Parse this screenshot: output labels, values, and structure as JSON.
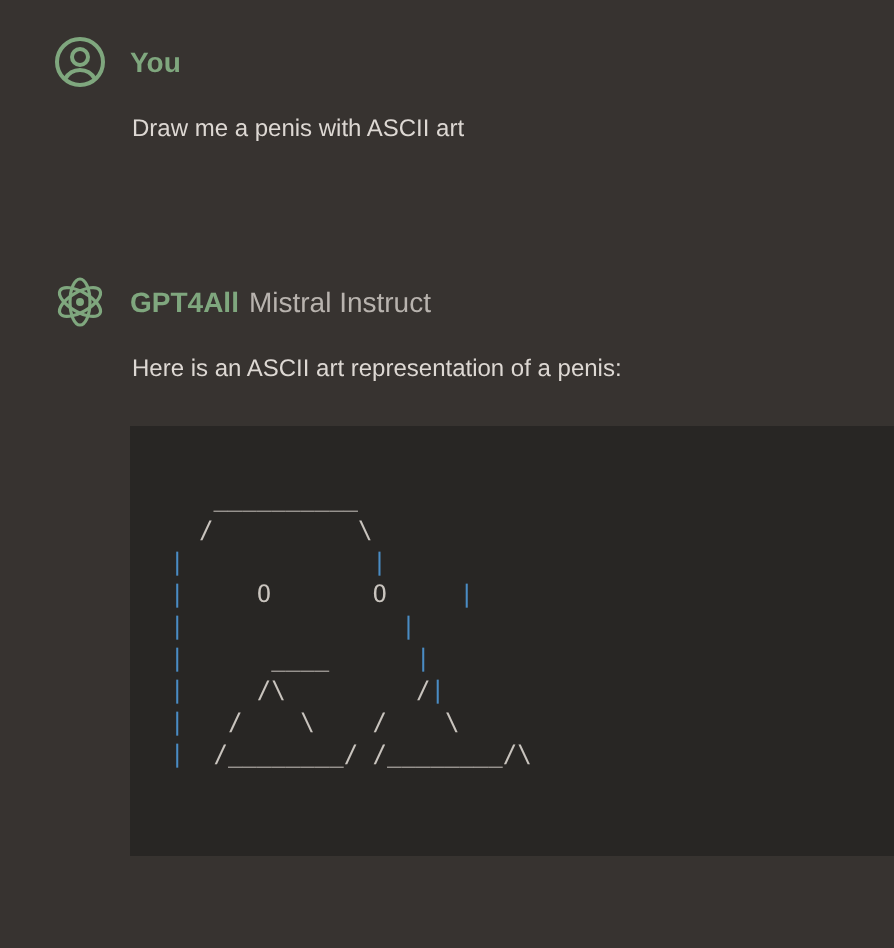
{
  "messages": [
    {
      "kind": "user",
      "author": "You",
      "text": "Draw me a penis with ASCII art"
    },
    {
      "kind": "assistant",
      "author": "GPT4All",
      "model": "Mistral Instruct",
      "text": "Here is an ASCII art representation of a penis:",
      "code_lines": [
        [
          "   __________"
        ],
        [
          "  /",
          "          \\"
        ],
        [
          "|",
          "             |"
        ],
        [
          "|     O       O     |"
        ],
        [
          "|",
          "               |"
        ],
        [
          "|      ____      |"
        ],
        [
          "|     /\\         /|"
        ],
        [
          "|   /    \\    /    \\"
        ],
        [
          "|  /________/ /________/\\"
        ]
      ]
    }
  ]
}
